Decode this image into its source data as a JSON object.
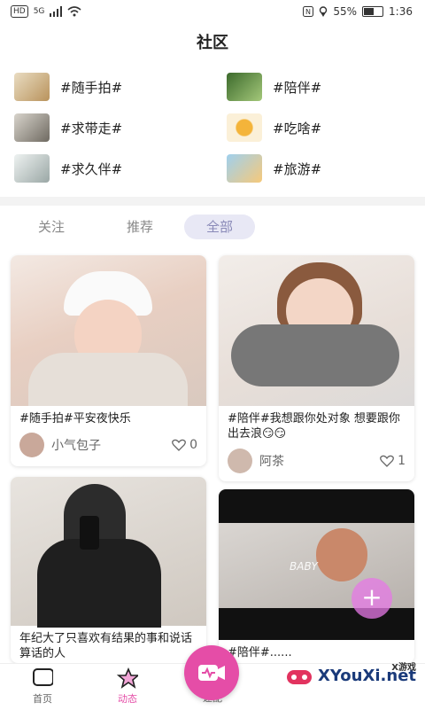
{
  "status_bar": {
    "signal": "5G",
    "hd": "HD",
    "battery": "55%",
    "time": "1:36"
  },
  "header": {
    "title": "社区"
  },
  "topics": [
    {
      "label": "#随手拍#"
    },
    {
      "label": "#陪伴#"
    },
    {
      "label": "#求带走#"
    },
    {
      "label": "#吃啥#"
    },
    {
      "label": "#求久伴#"
    },
    {
      "label": "#旅游#"
    }
  ],
  "tabs": [
    {
      "label": "关注"
    },
    {
      "label": "推荐"
    },
    {
      "label": "全部"
    }
  ],
  "posts": [
    {
      "text": "#随手拍#平安夜快乐",
      "user": "小气包子",
      "likes": "0"
    },
    {
      "text": "#陪伴#我想跟你处对象 想要跟你出去浪😏😏",
      "user": "阿茶",
      "likes": "1"
    },
    {
      "text": "年纪大了只喜欢有结果的事和说话算话的人",
      "user": "",
      "likes": ""
    },
    {
      "text": "#陪伴#......",
      "user": "",
      "likes": ""
    }
  ],
  "post_overlay": {
    "baby": "BABY"
  },
  "bottom_nav": [
    {
      "label": "首页"
    },
    {
      "label": "动态"
    },
    {
      "label": "速配"
    },
    {
      "label": ""
    },
    {
      "label": ""
    }
  ],
  "watermark": {
    "main": "XYouXi.net",
    "sup": "X游戏"
  }
}
